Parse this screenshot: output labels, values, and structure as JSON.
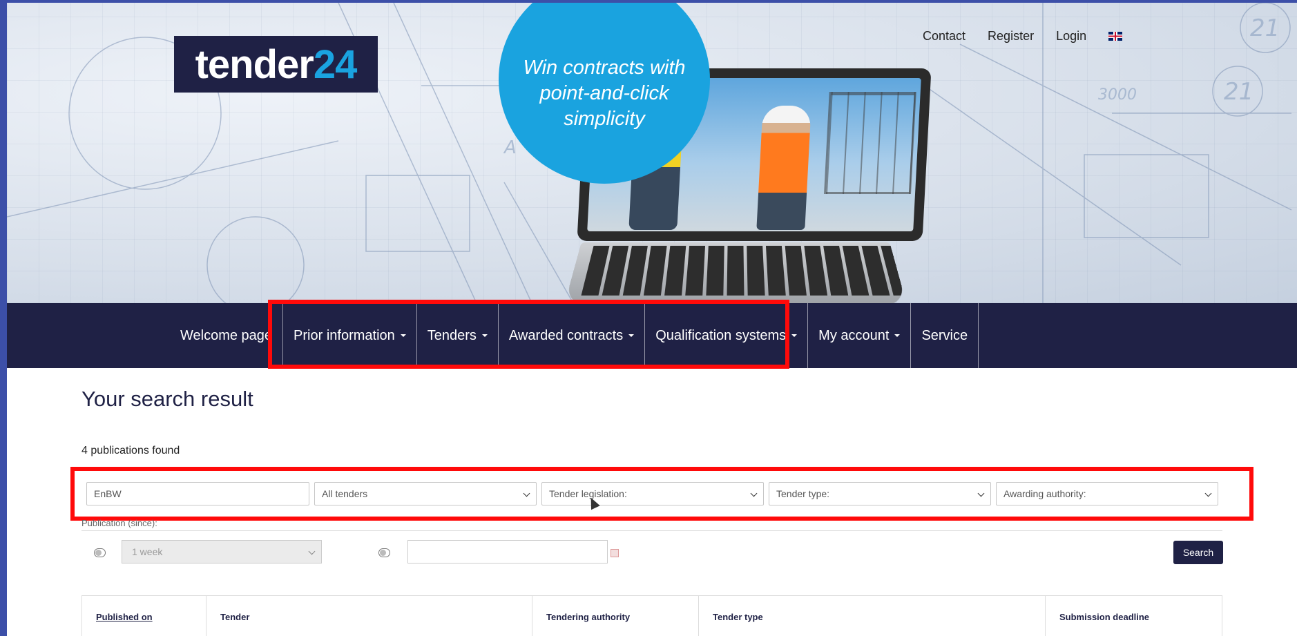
{
  "header": {
    "logo": {
      "part1": "tender",
      "part2": "24"
    },
    "tagline": "Win contracts with point-and-click simplicity",
    "top_links": [
      "Contact",
      "Register",
      "Login"
    ],
    "language_flag_icon": "uk-flag-icon"
  },
  "nav": {
    "items": [
      {
        "label": "Welcome page",
        "dropdown": false
      },
      {
        "label": "Prior information",
        "dropdown": true
      },
      {
        "label": "Tenders",
        "dropdown": true
      },
      {
        "label": "Awarded contracts",
        "dropdown": true
      },
      {
        "label": "Qualification systems",
        "dropdown": true
      },
      {
        "label": "My account",
        "dropdown": true
      },
      {
        "label": "Service",
        "dropdown": false
      }
    ]
  },
  "main": {
    "title": "Your search result",
    "results_count": "4 publications found",
    "filters": {
      "search_value": "EnBW",
      "tenders_select": "All tenders",
      "legislation_select": "Tender legislation:",
      "type_select": "Tender type:",
      "authority_select": "Awarding authority:"
    },
    "publication_label": "Publication (since):",
    "period_select": "1 week",
    "date_value": "",
    "search_button": "Search",
    "table_headers": [
      "Published on",
      "Tender",
      "Tendering authority",
      "Tender type",
      "Submission deadline"
    ]
  },
  "colors": {
    "navy": "#1f2145",
    "accent_blue": "#1aa3df",
    "highlight_red": "#ff0a0a",
    "frame_blue": "#3c4fa8"
  }
}
